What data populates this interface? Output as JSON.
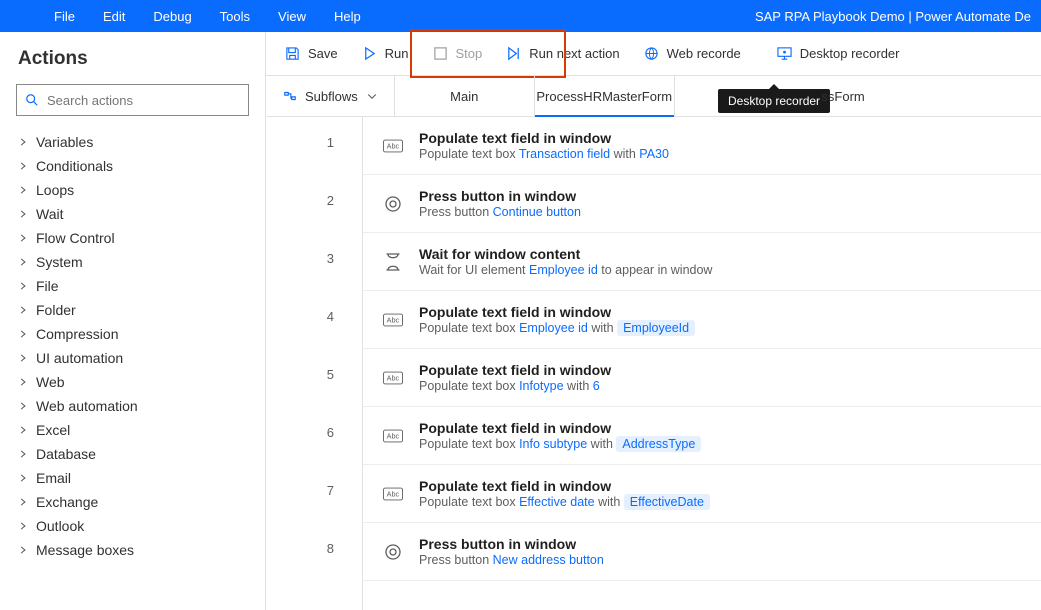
{
  "header": {
    "menus": [
      "File",
      "Edit",
      "Debug",
      "Tools",
      "View",
      "Help"
    ],
    "title": "SAP RPA Playbook Demo | Power Automate De"
  },
  "toolbar": {
    "save": "Save",
    "run": "Run",
    "stop": "Stop",
    "run_next": "Run next action",
    "web_rec": "Web recorde",
    "desktop_rec": "Desktop recorder"
  },
  "tooltip": "Desktop recorder",
  "sidebar": {
    "title": "Actions",
    "search_placeholder": "Search actions",
    "groups": [
      "Variables",
      "Conditionals",
      "Loops",
      "Wait",
      "Flow Control",
      "System",
      "File",
      "Folder",
      "Compression",
      "UI automation",
      "Web",
      "Web automation",
      "Excel",
      "Database",
      "Email",
      "Exchange",
      "Outlook",
      "Message boxes"
    ]
  },
  "subflows_label": "Subflows",
  "tabs": [
    {
      "label": "Main",
      "active": false
    },
    {
      "label": "ProcessHRMasterForm",
      "active": true
    },
    {
      "label": "ssForm",
      "active": false,
      "partial": true
    }
  ],
  "steps": [
    {
      "n": 1,
      "icon": "text",
      "title": "Populate text field in window",
      "desc_pre": "Populate text box ",
      "link": "Transaction field",
      "desc_mid": " with ",
      "value": "PA30",
      "pill": false
    },
    {
      "n": 2,
      "icon": "press",
      "title": "Press button in window",
      "desc_pre": "Press button ",
      "link": "Continue button",
      "desc_mid": "",
      "value": "",
      "pill": false
    },
    {
      "n": 3,
      "icon": "wait",
      "title": "Wait for window content",
      "desc_pre": "Wait for UI element ",
      "link": "Employee id",
      "desc_mid": " to appear in window",
      "value": "",
      "pill": false
    },
    {
      "n": 4,
      "icon": "text",
      "title": "Populate text field in window",
      "desc_pre": "Populate text box ",
      "link": "Employee id",
      "desc_mid": " with ",
      "value": "EmployeeId",
      "pill": true
    },
    {
      "n": 5,
      "icon": "text",
      "title": "Populate text field in window",
      "desc_pre": "Populate text box ",
      "link": "Infotype",
      "desc_mid": " with ",
      "value": "6",
      "pill": false
    },
    {
      "n": 6,
      "icon": "text",
      "title": "Populate text field in window",
      "desc_pre": "Populate text box ",
      "link": "Info subtype",
      "desc_mid": " with ",
      "value": "AddressType",
      "pill": true
    },
    {
      "n": 7,
      "icon": "text",
      "title": "Populate text field in window",
      "desc_pre": "Populate text box ",
      "link": "Effective date",
      "desc_mid": " with ",
      "value": "EffectiveDate",
      "pill": true
    },
    {
      "n": 8,
      "icon": "press",
      "title": "Press button in window",
      "desc_pre": "Press button ",
      "link": "New address button",
      "desc_mid": "",
      "value": "",
      "pill": false
    }
  ]
}
